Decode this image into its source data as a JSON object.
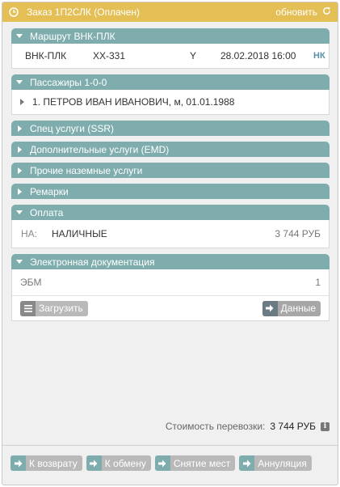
{
  "header": {
    "title": "Заказ 1П2СЛК (Оплачен)",
    "refresh_label": "обновить"
  },
  "route": {
    "section_title": "Маршрут  ВНК-ПЛК",
    "segment": "ВНК-ПЛК",
    "flight": "XX-331",
    "class": "Y",
    "datetime": "28.02.2018 16:00",
    "status": "НК"
  },
  "passengers": {
    "section_title": "Пассажиры 1-0-0",
    "items": [
      "1. ПЕТРОВ ИВАН ИВАНОВИЧ, м, 01.01.1988"
    ]
  },
  "collapsed_sections": [
    "Спец услуги (SSR)",
    "Дополнительные услуги (EMD)",
    "Прочие наземные услуги",
    "Ремарки"
  ],
  "payment": {
    "section_title": "Оплата",
    "code": "НА:",
    "method": "НАЛИЧНЫЕ",
    "amount": "3 744 РУБ"
  },
  "edocs": {
    "section_title": "Электронная документация",
    "label": "ЭБМ",
    "count": "1",
    "upload_label": "Загрузить",
    "data_label": "Данные"
  },
  "cost": {
    "label": "Стоимость перевозки:",
    "amount": "3 744 РУБ"
  },
  "actions": {
    "refund": "К возврату",
    "exchange": "К обмену",
    "remove_seats": "Снятие мест",
    "cancel": "Аннуляция"
  },
  "colors": {
    "header_accent": "#e4bf56",
    "section_header": "#7fadae",
    "button_grey": "#b9b9b9",
    "status_nk": "#5a8fa6"
  }
}
